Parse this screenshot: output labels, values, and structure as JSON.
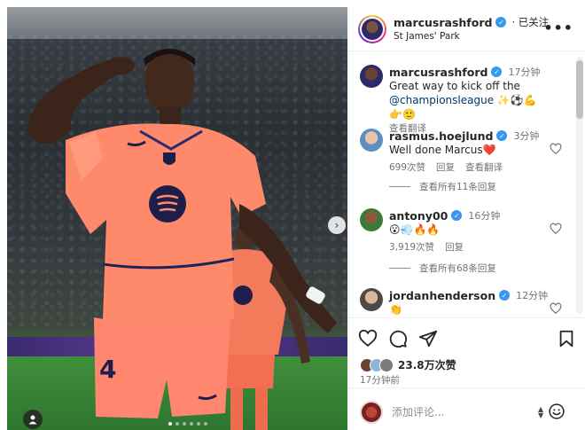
{
  "post": {
    "author": "marcusrashford",
    "follow_state": "· 已关注",
    "location": "St James' Park",
    "more": "•••",
    "carousel_next": "›",
    "likes": "23.8万次赞",
    "time_ago": "17分钟前",
    "carousel_total": 6,
    "carousel_index": 1
  },
  "caption": {
    "username": "marcusrashford",
    "time": "17分钟",
    "text": "Great way to kick off the",
    "mention": "@championsleague",
    "emojis": "✨⚽💪👉🙂",
    "translate": "查看翻译"
  },
  "comments": [
    {
      "username": "rasmus.hoejlund",
      "time": "3分钟",
      "text": "Well done Marcus❤️",
      "likes": "699次赞",
      "reply": "回复",
      "translate": "查看翻译",
      "view_replies": "查看所有11条回复"
    },
    {
      "username": "antony00",
      "time": "16分钟",
      "text": "😮💨🔥🔥",
      "likes": "3,919次赞",
      "reply": "回复",
      "view_replies": "查看所有68条回复"
    },
    {
      "username": "jordanhenderson",
      "time": "12分钟",
      "text": "👏"
    }
  ],
  "add_comment": {
    "placeholder": "添加评论..."
  },
  "icons": {
    "like": "heart-icon",
    "comment": "comment-icon",
    "share": "share-icon",
    "save": "bookmark-icon",
    "emoji": "emoji-icon",
    "user_tag": "user-icon"
  },
  "colors": {
    "verified": "#3897f0",
    "jersey": "#ff8a6b",
    "link": "#00376b",
    "secondary_text": "#737373"
  }
}
